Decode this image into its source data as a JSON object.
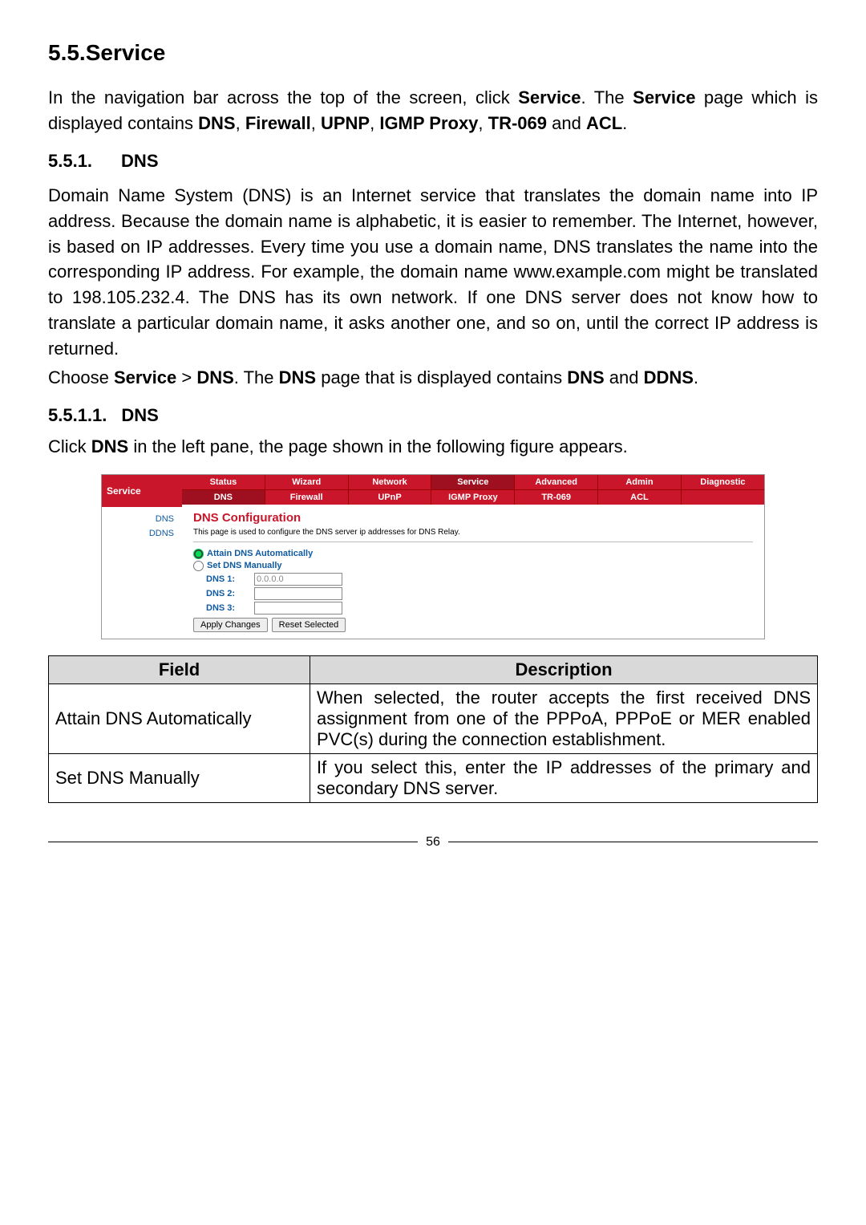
{
  "headings": {
    "h1_num": "5.5.",
    "h1_text": "Service",
    "h2_num": "5.5.1.",
    "h2_text": "DNS",
    "h3_num": "5.5.1.1.",
    "h3_text": "DNS"
  },
  "paragraphs": {
    "intro_1": "In the navigation bar across the top of the screen, click ",
    "intro_b1": "Service",
    "intro_2": ". The ",
    "intro_b2": "Service",
    "intro_3": " page which is displayed contains ",
    "intro_b3": "DNS",
    "intro_4": ", ",
    "intro_b4": "Firewall",
    "intro_5": ", ",
    "intro_b5": "UPNP",
    "intro_6": ", ",
    "intro_b6": "IGMP Proxy",
    "intro_7": ", ",
    "intro_b7": "TR-069",
    "intro_8": " and ",
    "intro_b8": "ACL",
    "intro_9": ".",
    "dns_para": "Domain Name System (DNS) is an Internet service that translates the domain name into IP address. Because the domain name is alphabetic, it is easier to remember. The Internet, however, is based on IP addresses. Every time you use a domain name, DNS translates the name into the corresponding IP address. For example, the domain name www.example.com might be translated to 198.105.232.4. The DNS has its own network. If one DNS server does not know how to translate a particular domain name, it asks another one, and so on, until the correct IP address is returned.",
    "choose_1": "Choose ",
    "choose_b1": "Service",
    "choose_2": " > ",
    "choose_b2": "DNS",
    "choose_3": ". The ",
    "choose_b3": "DNS",
    "choose_4": " page that is displayed contains ",
    "choose_b4": "DNS",
    "choose_5": " and ",
    "choose_b5": "DDNS",
    "choose_6": ".",
    "click_1": "Click ",
    "click_b1": "DNS",
    "click_2": " in the left pane, the page shown in the following figure appears."
  },
  "screenshot": {
    "side_label": "Service",
    "side_items": [
      "DNS",
      "DDNS"
    ],
    "tabs1": [
      "Status",
      "Wizard",
      "Network",
      "Service",
      "Advanced",
      "Admin",
      "Diagnostic"
    ],
    "tabs2": [
      "DNS",
      "Firewall",
      "UPnP",
      "IGMP Proxy",
      "TR-069",
      "ACL",
      ""
    ],
    "title": "DNS Configuration",
    "desc": "This page is used to configure the DNS server ip addresses for DNS Relay.",
    "radio_auto": "Attain DNS Automatically",
    "radio_manual": "Set DNS Manually",
    "dns1_label": "DNS 1:",
    "dns2_label": "DNS 2:",
    "dns3_label": "DNS 3:",
    "dns1_value": "0.0.0.0",
    "btn_apply": "Apply Changes",
    "btn_reset": "Reset Selected"
  },
  "table": {
    "header_field": "Field",
    "header_desc": "Description",
    "rows": [
      {
        "field": "Attain DNS Automatically",
        "desc": "When selected, the router accepts the first received DNS assignment from one of the PPPoA, PPPoE or MER enabled PVC(s) during the connection establishment."
      },
      {
        "field": "Set DNS Manually",
        "desc": "If you select this, enter the IP addresses of the primary and secondary DNS server."
      }
    ]
  },
  "page_number": "56"
}
